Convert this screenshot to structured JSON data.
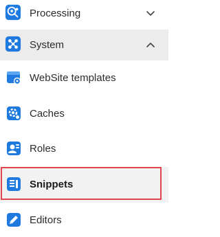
{
  "colors": {
    "accent": "#1f7ae0",
    "selected_bg": "#ececec",
    "active_bg": "#f2f2f2",
    "highlight_border": "#e0444f"
  },
  "groups": [
    {
      "label": "Processing",
      "icon": "brain-gear-icon",
      "expanded": false,
      "chevron": "chevron-down-icon"
    },
    {
      "label": "System",
      "icon": "system-nodes-icon",
      "expanded": true,
      "chevron": "chevron-up-icon"
    }
  ],
  "system_items": [
    {
      "label": "WebSite templates",
      "icon": "website-template-icon"
    },
    {
      "label": "Caches",
      "icon": "cache-gear-icon"
    },
    {
      "label": "Roles",
      "icon": "roles-person-icon"
    },
    {
      "label": "Snippets",
      "icon": "snippets-icon",
      "active": true
    },
    {
      "label": "Editors",
      "icon": "editor-pencil-icon"
    }
  ]
}
